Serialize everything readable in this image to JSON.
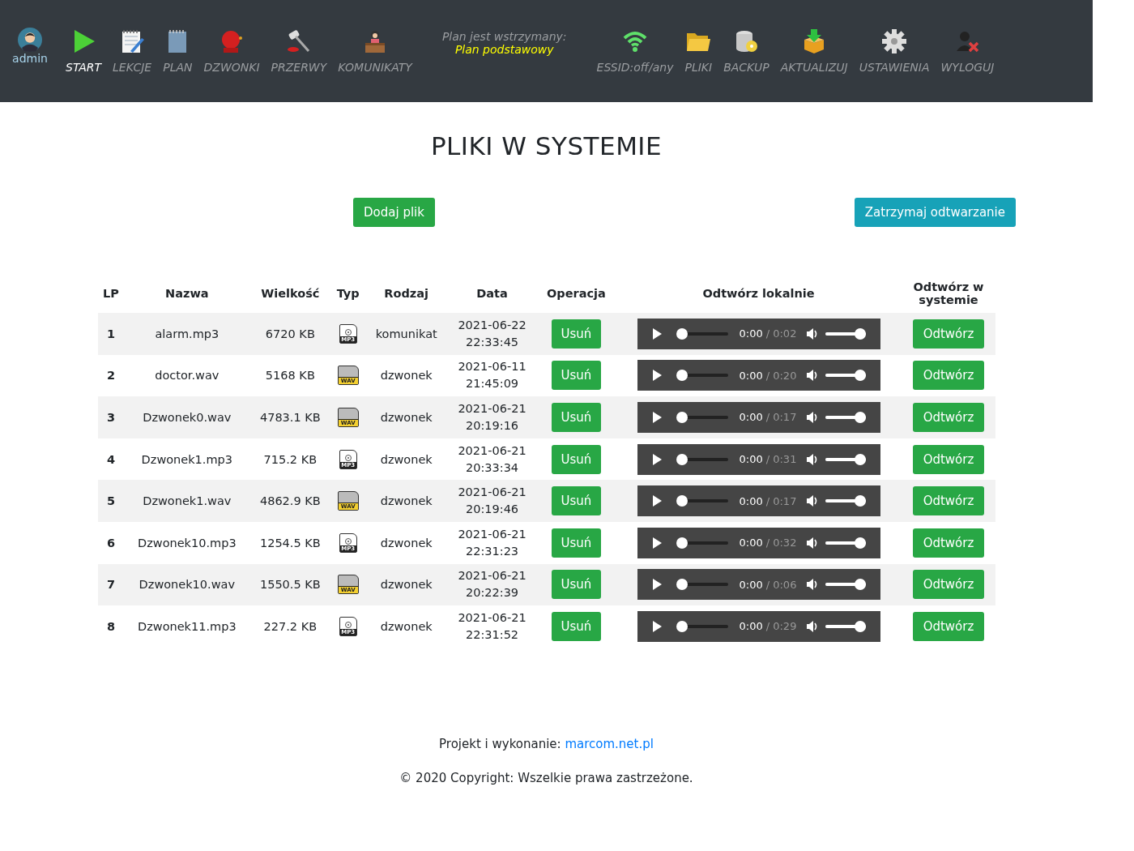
{
  "nav": {
    "user": {
      "label": "admin"
    },
    "items": [
      {
        "kind": "start",
        "label": "START",
        "selected": true
      },
      {
        "kind": "lessons",
        "label": "LEKCJE",
        "selected": false
      },
      {
        "kind": "plan",
        "label": "PLAN",
        "selected": false
      },
      {
        "kind": "bells",
        "label": "DZWONKI",
        "selected": false
      },
      {
        "kind": "breaks",
        "label": "PRZERWY",
        "selected": false
      },
      {
        "kind": "messages",
        "label": "KOMUNIKATY",
        "selected": false
      }
    ],
    "status": {
      "line_1": "Plan jest wstrzymany:",
      "line_2": "Plan podstawowy"
    },
    "right_items": [
      {
        "kind": "wifi",
        "label": "ESSID:off/any",
        "selected": false
      },
      {
        "kind": "files",
        "label": "PLIKI",
        "selected": false
      },
      {
        "kind": "backup",
        "label": "BACKUP",
        "selected": false
      },
      {
        "kind": "update",
        "label": "AKTUALIZUJ",
        "selected": false
      },
      {
        "kind": "settings",
        "label": "USTAWIENIA",
        "selected": false
      },
      {
        "kind": "logout",
        "label": "WYLOGUJ",
        "selected": false
      }
    ]
  },
  "title": "PLIKI W SYSTEMIE",
  "buttons": {
    "add": "Dodaj plik",
    "stop": "Zatrzymaj odtwarzanie"
  },
  "table": {
    "columns": [
      "LP",
      "Nazwa",
      "Wielkość",
      "Typ",
      "Rodzaj",
      "Data",
      "Operacja",
      "Odtwórz lokalnie",
      "Odtwórz w systemie"
    ],
    "rows": [
      {
        "lp": "1",
        "name": "alarm.mp3",
        "size": "6720 KB",
        "kind": "mp3",
        "type_label": "MP3",
        "category": "komunikat",
        "date": "2021-06-22",
        "time": "22:33:45",
        "delete": "Usuń",
        "player": {
          "current": "0:00",
          "duration": "/ 0:02",
          "progress": {
            "level": 0
          },
          "volume": {
            "level": 1
          }
        },
        "play": "Odtwórz"
      },
      {
        "lp": "2",
        "name": "doctor.wav",
        "size": "5168 KB",
        "kind": "wav",
        "type_label": "WAV",
        "category": "dzwonek",
        "date": "2021-06-11",
        "time": "21:45:09",
        "delete": "Usuń",
        "player": {
          "current": "0:00",
          "duration": "/ 0:20",
          "progress": {
            "level": 0
          },
          "volume": {
            "level": 1
          }
        },
        "play": "Odtwórz"
      },
      {
        "lp": "3",
        "name": "Dzwonek0.wav",
        "size": "4783.1 KB",
        "kind": "wav",
        "type_label": "WAV",
        "category": "dzwonek",
        "date": "2021-06-21",
        "time": "20:19:16",
        "delete": "Usuń",
        "player": {
          "current": "0:00",
          "duration": "/ 0:17",
          "progress": {
            "level": 0
          },
          "volume": {
            "level": 1
          }
        },
        "play": "Odtwórz"
      },
      {
        "lp": "4",
        "name": "Dzwonek1.mp3",
        "size": "715.2 KB",
        "kind": "mp3",
        "type_label": "MP3",
        "category": "dzwonek",
        "date": "2021-06-21",
        "time": "20:33:34",
        "delete": "Usuń",
        "player": {
          "current": "0:00",
          "duration": "/ 0:31",
          "progress": {
            "level": 0
          },
          "volume": {
            "level": 1
          }
        },
        "play": "Odtwórz"
      },
      {
        "lp": "5",
        "name": "Dzwonek1.wav",
        "size": "4862.9 KB",
        "kind": "wav",
        "type_label": "WAV",
        "category": "dzwonek",
        "date": "2021-06-21",
        "time": "20:19:46",
        "delete": "Usuń",
        "player": {
          "current": "0:00",
          "duration": "/ 0:17",
          "progress": {
            "level": 0
          },
          "volume": {
            "level": 1
          }
        },
        "play": "Odtwórz"
      },
      {
        "lp": "6",
        "name": "Dzwonek10.mp3",
        "size": "1254.5 KB",
        "kind": "mp3",
        "type_label": "MP3",
        "category": "dzwonek",
        "date": "2021-06-21",
        "time": "22:31:23",
        "delete": "Usuń",
        "player": {
          "current": "0:00",
          "duration": "/ 0:32",
          "progress": {
            "level": 0
          },
          "volume": {
            "level": 1
          }
        },
        "play": "Odtwórz"
      },
      {
        "lp": "7",
        "name": "Dzwonek10.wav",
        "size": "1550.5 KB",
        "kind": "wav",
        "type_label": "WAV",
        "category": "dzwonek",
        "date": "2021-06-21",
        "time": "20:22:39",
        "delete": "Usuń",
        "player": {
          "current": "0:00",
          "duration": "/ 0:06",
          "progress": {
            "level": 0
          },
          "volume": {
            "level": 1
          }
        },
        "play": "Odtwórz"
      },
      {
        "lp": "8",
        "name": "Dzwonek11.mp3",
        "size": "227.2 KB",
        "kind": "mp3",
        "type_label": "MP3",
        "category": "dzwonek",
        "date": "2021-06-21",
        "time": "22:31:52",
        "delete": "Usuń",
        "player": {
          "current": "0:00",
          "duration": "/ 0:29",
          "progress": {
            "level": 0
          },
          "volume": {
            "level": 1
          }
        },
        "play": "Odtwórz"
      }
    ]
  },
  "footer": {
    "credit": "Projekt i wykonanie:",
    "link": "marcom.net.pl",
    "copyright": "© 2020 Copyright: Wszelkie prawa zastrzeżone."
  }
}
